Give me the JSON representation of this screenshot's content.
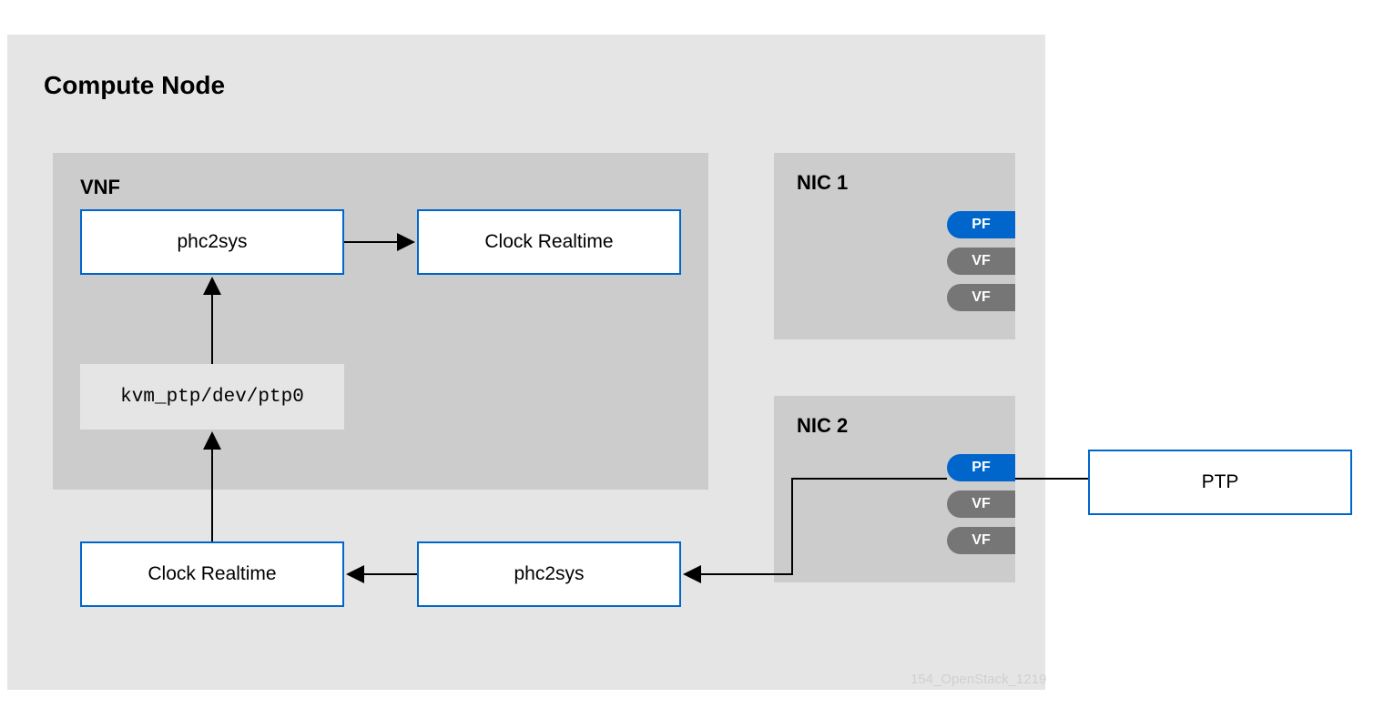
{
  "compute_node": {
    "title": "Compute Node"
  },
  "vnf": {
    "title": "VNF",
    "phc2sys": "phc2sys",
    "clock_realtime": "Clock Realtime",
    "kvm_ptp": "kvm_ptp/dev/ptp0"
  },
  "lower": {
    "clock_realtime": "Clock Realtime",
    "phc2sys": "phc2sys"
  },
  "nic1": {
    "title": "NIC 1",
    "pf": "PF",
    "vf1": "VF",
    "vf2": "VF"
  },
  "nic2": {
    "title": "NIC 2",
    "pf": "PF",
    "vf1": "VF",
    "vf2": "VF"
  },
  "ptp": {
    "label": "PTP"
  },
  "watermark": "154_OpenStack_1219"
}
